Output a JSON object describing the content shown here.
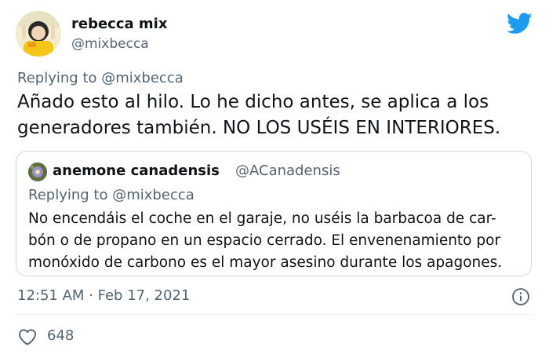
{
  "author": {
    "name": "rebecca mix",
    "handle": "@mixbecca",
    "avatar_icon": "profile-avatar"
  },
  "tweet": {
    "replying_prefix": "Replying to",
    "replying_to": "@mixbecca",
    "text": "Añado esto al hilo. Lo he dicho antes, se aplica a los generadores también. NO LOS USÉIS EN INTERIORES."
  },
  "quoted_tweet": {
    "author_name": "anemone canadensis",
    "author_handle": "@ACanadensis",
    "replying_prefix": "Replying to",
    "replying_to": "@mixbecca",
    "text_lines": [
      "No encendáis el coche en el garaje, no uséis la barbacoa de car-",
      "bón o de propano en un espacio cerrado. El envenenamiento por",
      "monóxido de carbono es el mayor asesino durante los apagones."
    ]
  },
  "meta": {
    "timestamp": "12:51 AM · Feb 17, 2021",
    "info_icon": "info-icon"
  },
  "actions": {
    "like_icon": "heart-icon",
    "like_count": "648"
  },
  "colors": {
    "brand": "#1d9bf0",
    "text": "#0f1419",
    "muted": "#536471",
    "border": "#cfd9de"
  }
}
